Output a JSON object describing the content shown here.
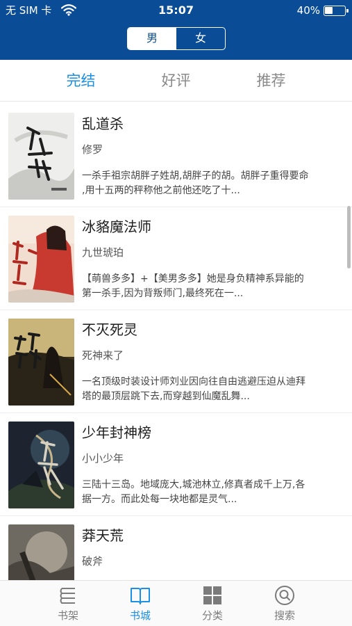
{
  "status_bar": {
    "carrier": "无 SIM 卡",
    "time": "15:07",
    "battery_percent": "40%",
    "battery_level": 0.4
  },
  "gender_switch": {
    "options": [
      "男",
      "女"
    ],
    "selected": "男"
  },
  "tabs": [
    {
      "label": "完结",
      "active": true
    },
    {
      "label": "好评",
      "active": false
    },
    {
      "label": "推荐",
      "active": false
    }
  ],
  "books": [
    {
      "title": "乱道杀",
      "author": "修罗",
      "description": "一杀手祖宗胡胖子姓胡,胡胖子的胡。胡胖子重得要命\n,用十五两的秤称他之前他还吃了十..."
    },
    {
      "title": "冰貉魔法师",
      "author": "九世琥珀",
      "description": "【萌兽多多】+【美男多多】她是身负精神系异能的\n第一杀手,因为背叛师门,最终死在一..."
    },
    {
      "title": "不灭死灵",
      "author": "死神来了",
      "description": "一名顶级时装设计师刘业因向往自由逃避压迫从迪拜\n塔的最顶层跳下去,而穿越到仙魔乱舞..."
    },
    {
      "title": "少年封神榜",
      "author": "小小少年",
      "description": "三陆十三岛。地域庞大,城池林立,修真者成千上万,各\n据一方。而此处每一块地都是灵气..."
    },
    {
      "title": "莽天荒",
      "author": "破斧",
      "description": ""
    }
  ],
  "bottom_nav": [
    {
      "label": "书架",
      "icon": "bookshelf-icon",
      "active": false
    },
    {
      "label": "书城",
      "icon": "open-book-icon",
      "active": true
    },
    {
      "label": "分类",
      "icon": "category-grid-icon",
      "active": false
    },
    {
      "label": "搜索",
      "icon": "search-icon",
      "active": false
    }
  ],
  "colors": {
    "header_bg": "#0a4d96",
    "accent": "#1a8fe3",
    "inactive": "#7b7b7b"
  }
}
